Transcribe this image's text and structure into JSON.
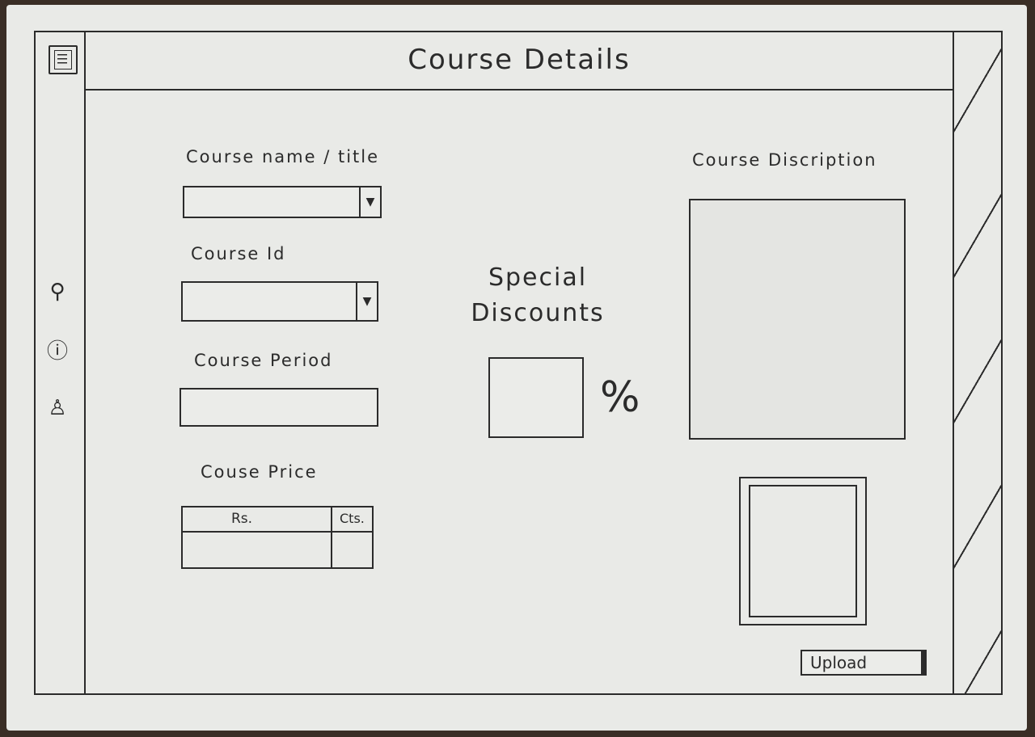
{
  "header": {
    "title": "Course Details"
  },
  "sidebar": {
    "icons": [
      "search-icon",
      "help-icon",
      "user-icon"
    ]
  },
  "form": {
    "course_name_label": "Course name / title",
    "course_id_label": "Course Id",
    "course_period_label": "Course Period",
    "course_price_label": "Couse Price",
    "price_rs_header": "Rs.",
    "price_cts_header": "Cts."
  },
  "discounts": {
    "title_line1": "Special",
    "title_line2": "Discounts",
    "percent_symbol": "%"
  },
  "description": {
    "label": "Course Discription"
  },
  "upload": {
    "label": "Upload"
  }
}
